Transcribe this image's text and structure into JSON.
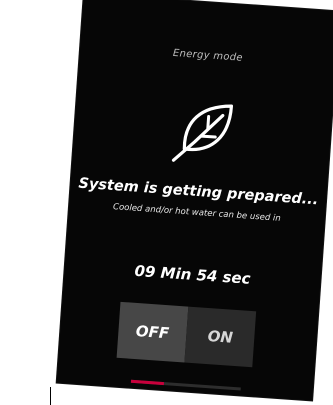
{
  "screen": {
    "mode_label": "Energy mode",
    "icon": "leaf-icon",
    "headline": "System is getting prepared...",
    "subline": "Cooled and/or hot water can be used in",
    "countdown": "09 Min 54 sec"
  },
  "toggle": {
    "off_label": "OFF",
    "on_label": "ON",
    "selected": "OFF"
  },
  "progress": {
    "fraction": 0.3,
    "color": "#c8003c"
  },
  "colors": {
    "screen_bg": "#060606",
    "off_bg": "#474747",
    "on_bg": "#2a2a2a"
  }
}
